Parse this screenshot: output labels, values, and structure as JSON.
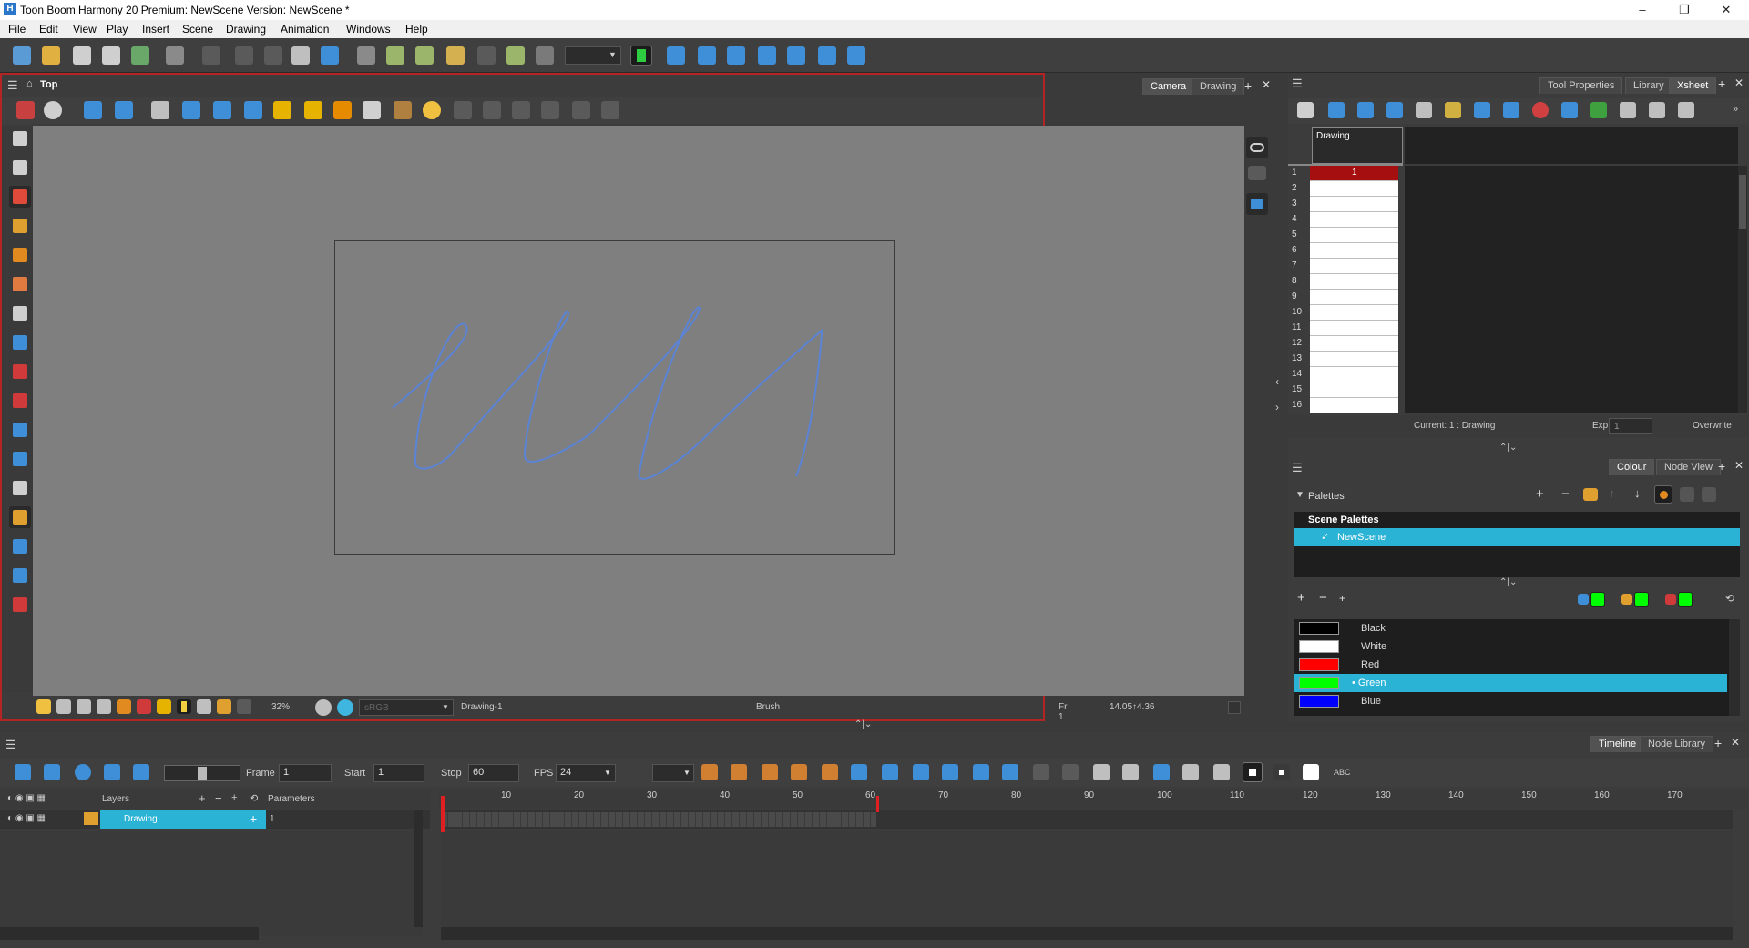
{
  "window": {
    "title": "Toon Boom Harmony 20 Premium: NewScene Version: NewScene *",
    "app_icon": "H",
    "minimize": "–",
    "maximize": "❐",
    "close": "✕"
  },
  "menu": [
    "File",
    "Edit",
    "View",
    "Play",
    "Insert",
    "Scene",
    "Drawing",
    "Animation",
    "Windows",
    "Help"
  ],
  "camera_panel": {
    "view_label": "Top",
    "tabs": [
      "Camera",
      "Drawing"
    ],
    "status": {
      "zoom": "32%",
      "colorspace": "sRGB",
      "drawing": "Drawing-1",
      "tool": "Brush",
      "frame": "Fr 1",
      "coords": "14.05↑4.36"
    },
    "stroke_color": "#5b84d6",
    "stage_bg": "#7f7f7f"
  },
  "xsheet": {
    "tabs": [
      "Tool Properties",
      "Library",
      "Xsheet"
    ],
    "column_name": "Drawing",
    "rows": [
      "1",
      "2",
      "3",
      "4",
      "5",
      "6",
      "7",
      "8",
      "9",
      "10",
      "11",
      "12",
      "13",
      "14",
      "15",
      "16"
    ],
    "first_cell_value": "1",
    "current": "Current: 1 : Drawing",
    "exp_label": "Exp",
    "exp_value": "1",
    "overwrite": "Overwrite"
  },
  "colour_panel": {
    "tabs": [
      "Colour",
      "Node View"
    ],
    "palettes_label": "Palettes",
    "scene_palettes": "Scene Palettes",
    "palette_name": "NewScene",
    "colors": [
      {
        "name": "Black",
        "hex": "#000000"
      },
      {
        "name": "White",
        "hex": "#ffffff"
      },
      {
        "name": "Red",
        "hex": "#ff0000"
      },
      {
        "name": "Green",
        "hex": "#00ff00"
      },
      {
        "name": "Blue",
        "hex": "#0000ff"
      }
    ],
    "selected_color": "Green",
    "selection_bg": "#2bb3d6"
  },
  "timeline": {
    "tabs": [
      "Timeline",
      "Node Library"
    ],
    "frame_label": "Frame",
    "frame_value": "1",
    "start_label": "Start",
    "start_value": "1",
    "stop_label": "Stop",
    "stop_value": "60",
    "fps_label": "FPS",
    "fps_value": "24",
    "layers_header": "Layers",
    "parameters_header": "Parameters",
    "layer_name": "Drawing",
    "layer_param": "1",
    "ruler": [
      "10",
      "20",
      "30",
      "40",
      "50",
      "60",
      "70",
      "80",
      "90",
      "100",
      "110",
      "120",
      "130",
      "140",
      "150",
      "160",
      "170"
    ],
    "tb_text": "ABC"
  }
}
